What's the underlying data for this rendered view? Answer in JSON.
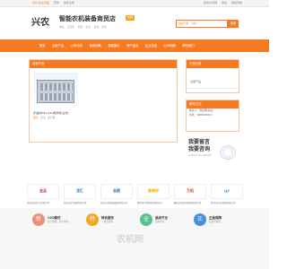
{
  "topbar": {
    "links": [
      "您好,欢迎光临",
      "登录",
      "免费注册"
    ],
    "right_links": [
      "我的牛商网",
      "我的",
      "网站导航"
    ]
  },
  "header": {
    "logo": "兴农",
    "shop_name": "智能农机装备商贸店",
    "badge": "优质",
    "meta": [
      "地址：江苏省",
      "服务：全天",
      "商家：直营"
    ],
    "search_scope": [
      "本店产品",
      "全站"
    ],
    "search_placeholder": "搜索产品",
    "search_button": "搜索"
  },
  "nav": {
    "items": [
      "首页",
      "全部产品",
      "公司动态",
      "营销战略",
      "视频展示",
      "商户留言",
      "企业信息",
      "公司相册",
      "联系我们"
    ]
  },
  "main": {
    "title": "全部产品",
    "product": {
      "name": "步进式8.5m-14m热风机(立式)",
      "price_label": "面议",
      "price_unit": "元/台",
      "price_note": "起订量"
    }
  },
  "sidebar": {
    "categories_title": "产品分类",
    "categories": [
      "全部产品"
    ],
    "contact_title": "联系方式",
    "contact_rows": [
      "联系人：周经理(先生)",
      "手机：18006465013"
    ],
    "promo": {
      "line1": "我要留言",
      "line2": "我要咨询",
      "line3": "CONSULTING SERVICE"
    }
  },
  "brands": [
    {
      "logo": "金品",
      "color": "#c0392b",
      "caption": "海城金品铁艺有限公司"
    },
    {
      "logo": "龙汇",
      "color": "#1e6fb8",
      "caption": "德州龙汇机械有限公司"
    },
    {
      "logo": "志航",
      "color": "#1e6fb8",
      "caption": "常州志航机械设备有限公司"
    },
    {
      "logo": "貴興祥",
      "color": "#f0b400",
      "caption": "潍坊贵兴祥机械有限公司"
    },
    {
      "logo": "万机",
      "color": "#c0392b",
      "caption": "重庆万机农业机械有限公司"
    },
    {
      "logo": "QZ",
      "color": "#1e6fb8",
      "caption": "开封市兴农机械有限公司"
    }
  ],
  "features": [
    {
      "icon": "新",
      "color": "#f08c7a",
      "title": "O2O模式",
      "sub": "线上购物，线下体验"
    },
    {
      "icon": "特",
      "color": "#f5a623",
      "title": "特色服务",
      "sub": "一站式采购"
    },
    {
      "icon": "全",
      "color": "#5ac18e",
      "title": "品类齐全",
      "sub": "品种丰富"
    },
    {
      "icon": "正",
      "color": "#4a90d9",
      "title": "正品保障",
      "sub": "质量有保障"
    }
  ],
  "watermark": "农机网"
}
